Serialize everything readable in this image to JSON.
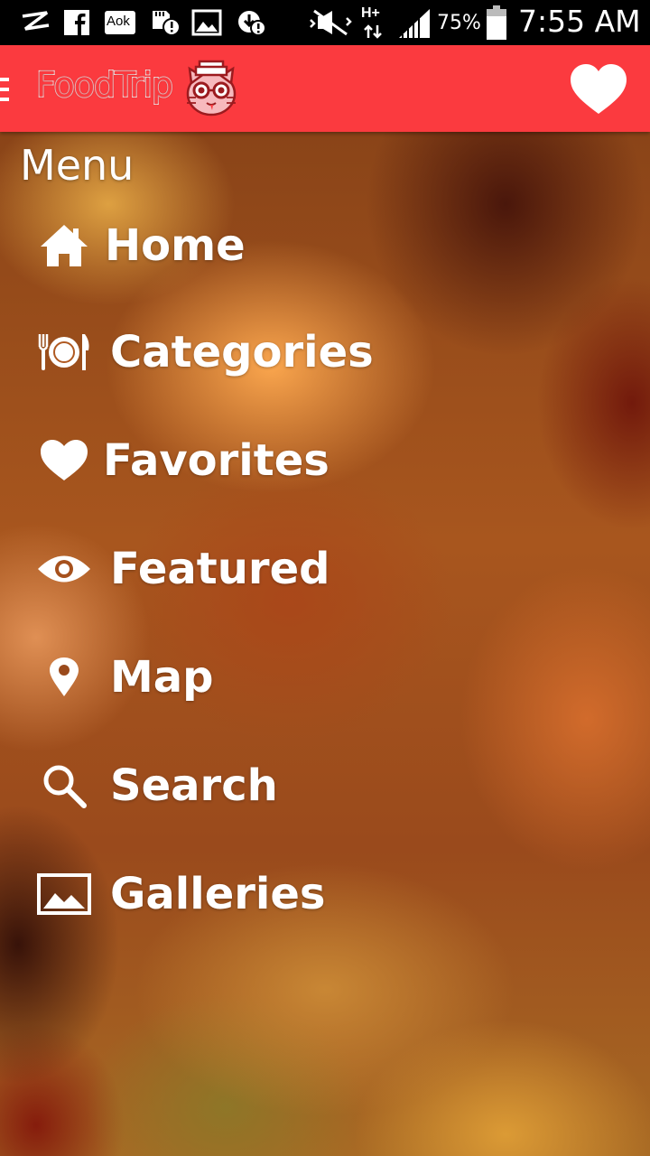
{
  "status_bar": {
    "battery_percent": "75%",
    "time": "7:55 AM",
    "network_type": "H+",
    "icons": [
      "carrier-icon",
      "facebook-icon",
      "aok-icon",
      "sd-card-alert-icon",
      "image-icon",
      "download-alert-icon",
      "mute-icon",
      "network-icon",
      "signal-icon",
      "battery-icon"
    ],
    "aok_label": "Aok"
  },
  "app_bar": {
    "logo_text": "FoodTrip",
    "brand_color": "#fb3a3f",
    "icons": [
      "hamburger-icon",
      "cat-logo-icon",
      "favorite-heart-icon"
    ]
  },
  "menu": {
    "title": "Menu",
    "items": [
      {
        "label": "Home",
        "icon": "home-icon"
      },
      {
        "label": "Categories",
        "icon": "plate-cutlery-icon"
      },
      {
        "label": "Favorites",
        "icon": "heart-icon"
      },
      {
        "label": "Featured",
        "icon": "eye-icon"
      },
      {
        "label": "Map",
        "icon": "map-pin-icon"
      },
      {
        "label": "Search",
        "icon": "search-icon"
      },
      {
        "label": "Galleries",
        "icon": "image-gallery-icon"
      }
    ]
  }
}
